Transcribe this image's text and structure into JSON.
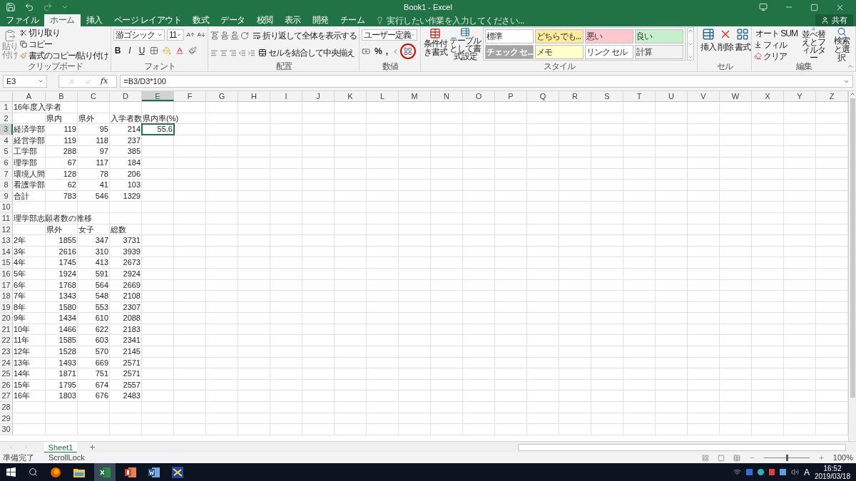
{
  "window": {
    "title": "Book1 - Excel",
    "share": "共有"
  },
  "tabs": [
    {
      "label": "ファイル",
      "selected": false
    },
    {
      "label": "ホーム",
      "selected": true
    },
    {
      "label": "挿入",
      "selected": false
    },
    {
      "label": "ページ レイアウト",
      "selected": false
    },
    {
      "label": "数式",
      "selected": false
    },
    {
      "label": "データ",
      "selected": false
    },
    {
      "label": "校閲",
      "selected": false
    },
    {
      "label": "表示",
      "selected": false
    },
    {
      "label": "開発",
      "selected": false
    },
    {
      "label": "チーム",
      "selected": false
    }
  ],
  "tell_me": {
    "placeholder": "実行したい作業を入力してください..."
  },
  "ribbon": {
    "clipboard": {
      "label": "クリップボード",
      "paste": "貼り付け",
      "items": [
        "切り取り",
        "コピー",
        "書式のコピー/貼り付け"
      ]
    },
    "font": {
      "label": "フォント",
      "font_name": "游ゴシック",
      "size": "11",
      "style_buttons": [
        "B",
        "I",
        "U"
      ]
    },
    "alignment": {
      "label": "配置",
      "wrap": "折り返して全体を表示する",
      "merge": "セルを結合して中央揃え"
    },
    "number": {
      "label": "数値",
      "format": "ユーザー定義",
      "buttons": [
        "%",
        ","
      ]
    },
    "styles": {
      "label": "スタイル",
      "conditional": "条件付き書式",
      "table": "テーブルとして書式設定",
      "cell_styles": [
        {
          "label": "標準",
          "color": "#ffffff"
        },
        {
          "label": "どちらでも...",
          "color": "#ffeb9c"
        },
        {
          "label": "悪い",
          "color": "#ffc7ce"
        },
        {
          "label": "良い",
          "color": "#c6efce"
        },
        {
          "label": "チェック セ...",
          "color": "#a5a5a5"
        },
        {
          "label": "メモ",
          "color": "#ffffcc"
        },
        {
          "label": "リンク セル",
          "color": "#ffffff"
        },
        {
          "label": "計算",
          "color": "#f2f2f2"
        }
      ]
    },
    "cells": {
      "label": "セル",
      "buttons": [
        "挿入",
        "削除",
        "書式"
      ]
    },
    "editing": {
      "label": "編集",
      "items": [
        "オート SUM",
        "フィル",
        "クリア"
      ],
      "sort": "並べ替えとフィルター",
      "find": "検索と選択"
    }
  },
  "formula_bar": {
    "name_box": "E3",
    "fx": "fx",
    "formula": "=B3/D3*100"
  },
  "columns": [
    {
      "label": "A",
      "selected": false
    },
    {
      "label": "B",
      "selected": false
    },
    {
      "label": "C",
      "selected": false
    },
    {
      "label": "D",
      "selected": false
    },
    {
      "label": "E",
      "selected": true
    },
    {
      "label": "F",
      "selected": false
    },
    {
      "label": "G",
      "selected": false
    },
    {
      "label": "H",
      "selected": false
    },
    {
      "label": "I",
      "selected": false
    },
    {
      "label": "J",
      "selected": false
    },
    {
      "label": "K",
      "selected": false
    },
    {
      "label": "L",
      "selected": false
    },
    {
      "label": "M",
      "selected": false
    },
    {
      "label": "N",
      "selected": false
    },
    {
      "label": "O",
      "selected": false
    },
    {
      "label": "P",
      "selected": false
    },
    {
      "label": "Q",
      "selected": false
    },
    {
      "label": "R",
      "selected": false
    },
    {
      "label": "S",
      "selected": false
    },
    {
      "label": "T",
      "selected": false
    },
    {
      "label": "U",
      "selected": false
    },
    {
      "label": "V",
      "selected": false
    },
    {
      "label": "W",
      "selected": false
    },
    {
      "label": "X",
      "selected": false
    },
    {
      "label": "Y",
      "selected": false
    },
    {
      "label": "Z",
      "selected": false
    }
  ],
  "rows": [
    {
      "number": "1",
      "selected": false,
      "kind": "text",
      "cells": [
        "16年度入学者"
      ]
    },
    {
      "number": "2",
      "selected": false,
      "kind": "text",
      "cells": [
        null,
        "県内",
        "県外",
        "入学者数",
        "県内率(%)"
      ]
    },
    {
      "number": "3",
      "selected": true,
      "kind": "data",
      "cells": [
        "経済学部",
        "119",
        "95",
        "214",
        "55.6"
      ]
    },
    {
      "number": "4",
      "selected": false,
      "kind": "data",
      "cells": [
        "経営学部",
        "119",
        "118",
        "237"
      ]
    },
    {
      "number": "5",
      "selected": false,
      "kind": "data",
      "cells": [
        "工学部",
        "288",
        "97",
        "385"
      ]
    },
    {
      "number": "6",
      "selected": false,
      "kind": "data",
      "cells": [
        "理学部",
        "67",
        "117",
        "184"
      ]
    },
    {
      "number": "7",
      "selected": false,
      "kind": "data",
      "cells": [
        "環境人間",
        "128",
        "78",
        "206"
      ]
    },
    {
      "number": "8",
      "selected": false,
      "kind": "data",
      "cells": [
        "看護学部",
        "62",
        "41",
        "103"
      ]
    },
    {
      "number": "9",
      "selected": false,
      "kind": "data",
      "cells": [
        "合計",
        "783",
        "546",
        "1329"
      ]
    },
    {
      "number": "10",
      "selected": false,
      "kind": "text",
      "cells": []
    },
    {
      "number": "11",
      "selected": false,
      "kind": "text",
      "cells": [
        "理学部志願者数の推移"
      ]
    },
    {
      "number": "12",
      "selected": false,
      "kind": "text",
      "cells": [
        null,
        "県外",
        "女子",
        "総数"
      ]
    },
    {
      "number": "13",
      "selected": false,
      "kind": "data",
      "cells": [
        "2年",
        "1855",
        "347",
        "3731"
      ]
    },
    {
      "number": "14",
      "selected": false,
      "kind": "data",
      "cells": [
        "3年",
        "2616",
        "310",
        "3939"
      ]
    },
    {
      "number": "15",
      "selected": false,
      "kind": "data",
      "cells": [
        "4年",
        "1745",
        "413",
        "2673"
      ]
    },
    {
      "number": "16",
      "selected": false,
      "kind": "data",
      "cells": [
        "5年",
        "1924",
        "591",
        "2924"
      ]
    },
    {
      "number": "17",
      "selected": false,
      "kind": "data",
      "cells": [
        "6年",
        "1768",
        "564",
        "2669"
      ]
    },
    {
      "number": "18",
      "selected": false,
      "kind": "data",
      "cells": [
        "7年",
        "1343",
        "548",
        "2108"
      ]
    },
    {
      "number": "19",
      "selected": false,
      "kind": "data",
      "cells": [
        "8年",
        "1580",
        "553",
        "2307"
      ]
    },
    {
      "number": "20",
      "selected": false,
      "kind": "data",
      "cells": [
        "9年",
        "1434",
        "610",
        "2088"
      ]
    },
    {
      "number": "21",
      "selected": false,
      "kind": "data",
      "cells": [
        "10年",
        "1466",
        "622",
        "2183"
      ]
    },
    {
      "number": "22",
      "selected": false,
      "kind": "data",
      "cells": [
        "11年",
        "1585",
        "603",
        "2341"
      ]
    },
    {
      "number": "23",
      "selected": false,
      "kind": "data",
      "cells": [
        "12年",
        "1528",
        "570",
        "2145"
      ]
    },
    {
      "number": "24",
      "selected": false,
      "kind": "data",
      "cells": [
        "13年",
        "1493",
        "669",
        "2571"
      ]
    },
    {
      "number": "25",
      "selected": false,
      "kind": "data",
      "cells": [
        "14年",
        "1871",
        "751",
        "2571"
      ]
    },
    {
      "number": "26",
      "selected": false,
      "kind": "data",
      "cells": [
        "15年",
        "1795",
        "674",
        "2557"
      ]
    },
    {
      "number": "27",
      "selected": false,
      "kind": "data",
      "cells": [
        "16年",
        "1803",
        "676",
        "2483"
      ]
    },
    {
      "number": "28",
      "selected": false,
      "kind": "text",
      "cells": []
    },
    {
      "number": "29",
      "selected": false,
      "kind": "text",
      "cells": []
    },
    {
      "number": "30",
      "selected": false,
      "kind": "text",
      "cells": []
    }
  ],
  "sheet_tabs": [
    {
      "label": "Sheet1",
      "selected": true
    }
  ],
  "status_bar": {
    "items": [
      "準備完了",
      "ScrollLock"
    ],
    "zoom": "100%",
    "level": 0.5
  },
  "taskbar": {
    "ime": "A",
    "time": "16:52",
    "date": "2019/03/18"
  }
}
